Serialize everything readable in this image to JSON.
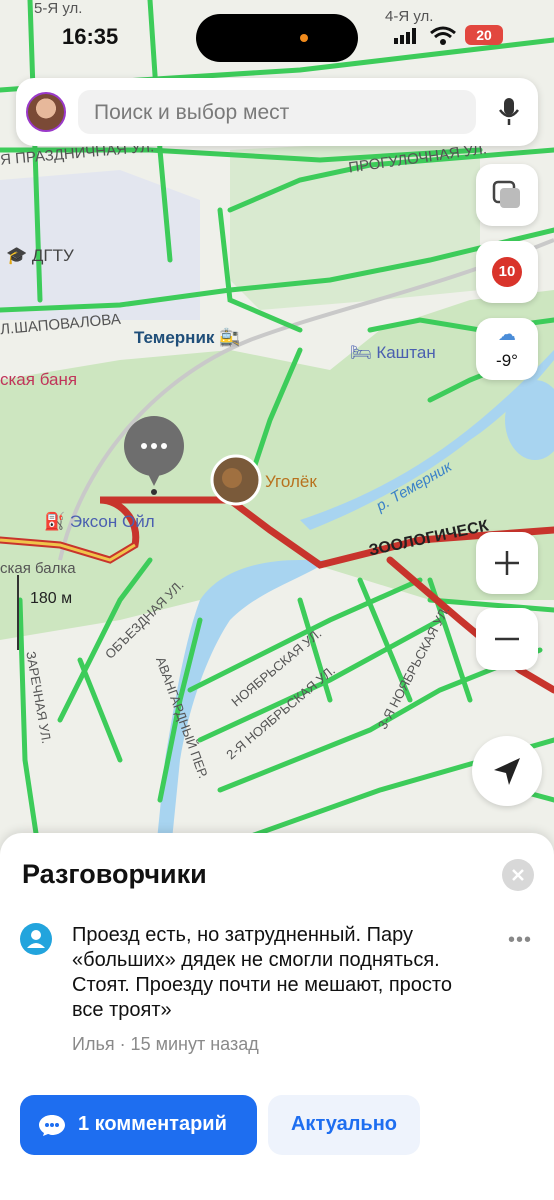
{
  "status_bar": {
    "time": "16:35",
    "battery": "20"
  },
  "search": {
    "placeholder": "Поиск и выбор мест"
  },
  "map": {
    "street_labels": [
      "5-Я ул.",
      "4-Я ул.",
      "ПРОГУЛОЧНАЯ УЛ.",
      "Я ПРАЗДНИЧНАЯ УЛ.",
      "ПРОГУЛОЧНЕН",
      "Л.ШАПОВАЛОВА",
      "ЗООЛОГИЧЕСК",
      "ОБЪЕЗДНАЯ УЛ.",
      "НОЯБРЬСКАЯ УЛ.",
      "2-Я НОЯБРЬСКАЯ УЛ.",
      "3-Я НОЯБРЬСКАЯ УЛ.",
      "АВАНГАРДНЫЙ ПЕР.",
      "ЗАРЕЧНАЯ УЛ.",
      "р. Темерник"
    ],
    "pois": {
      "dgtu": "ДГТУ",
      "station": "Темерник",
      "kashtan": "Каштан",
      "banya": "ская баня",
      "ugolek": "Уголёк",
      "exxon": "Эксон Ойл",
      "balka": "ская балка"
    },
    "scale": "180 м",
    "traffic_level": "10",
    "weather_temp": "-9°"
  },
  "sheet": {
    "title": "Разговорчики",
    "comment": "Проезд есть, но затрудненный. Пару «больших» дядек не смогли подняться. Стоят. Проезду почти не мешают, просто все троят»",
    "meta": "Илья · 15 минут назад",
    "more": "•••",
    "comments_button": "1 комментарий",
    "actual_button": "Актуально"
  },
  "colors": {
    "accent": "#1e6ef0",
    "traffic_green": "#3dcc5a",
    "traffic_red": "#c8342c",
    "battery": "#e2473f"
  }
}
